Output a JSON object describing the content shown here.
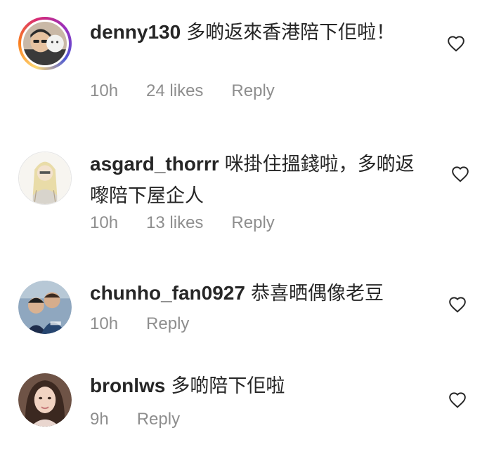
{
  "comments": [
    {
      "username": "denny130",
      "text": "多啲返來香港陪下佢啦！",
      "time": "10h",
      "likes": "24 likes",
      "reply": "Reply",
      "has_story": true
    },
    {
      "username": "asgard_thorrr",
      "text": "咪掛住搵錢啦，多啲返嚟陪下屋企人",
      "time": "10h",
      "likes": "13 likes",
      "reply": "Reply",
      "has_story": false
    },
    {
      "username": "chunho_fan0927",
      "text": "恭喜晒偶像老豆",
      "time": "10h",
      "likes": "",
      "reply": "Reply",
      "has_story": false
    },
    {
      "username": "bronlws",
      "text": "多啲陪下佢啦",
      "time": "9h",
      "likes": "",
      "reply": "Reply",
      "has_story": false
    }
  ],
  "icons": {
    "like": "heart-outline-icon"
  },
  "colors": {
    "text": "#262626",
    "meta": "#8e8e8e",
    "background": "#ffffff"
  }
}
